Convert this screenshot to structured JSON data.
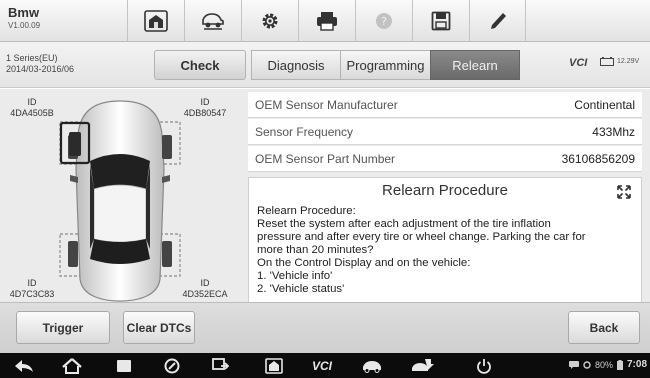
{
  "app": {
    "name": "Bmw",
    "version": "V1.00.09"
  },
  "toolbar": {
    "icons": [
      "home-icon",
      "vehicle-lift-icon",
      "settings-icon",
      "print-icon",
      "help-icon",
      "save-icon",
      "edit-icon"
    ]
  },
  "vehicle": {
    "model": "1 Series(EU)",
    "years": "2014/03-2016/06"
  },
  "function_bar": {
    "check_label": "Check",
    "tabs": [
      {
        "label": "Diagnosis",
        "active": false
      },
      {
        "label": "Programming",
        "active": false
      },
      {
        "label": "Relearn",
        "active": true
      }
    ],
    "vci_label": "VCI",
    "battery_voltage": "12.29V"
  },
  "tires": {
    "front_left": {
      "caption": "ID",
      "id": "4DA4505B",
      "selected": true
    },
    "front_right": {
      "caption": "ID",
      "id": "4DB80547",
      "selected": false
    },
    "rear_left": {
      "caption": "ID",
      "id": "4D7C3C83",
      "selected": false
    },
    "rear_right": {
      "caption": "ID",
      "id": "4D352ECA",
      "selected": false
    }
  },
  "sensor_info": [
    {
      "label": "OEM Sensor Manufacturer",
      "value": "Continental"
    },
    {
      "label": "Sensor Frequency",
      "value": "433Mhz"
    },
    {
      "label": "OEM Sensor Part Number",
      "value": "36106856209"
    }
  ],
  "procedure": {
    "title": "Relearn Procedure",
    "lines": [
      "Relearn Procedure:",
      "Reset the system after each adjustment of the tire inflation",
      "pressure and after every tire or wheel change. Parking the car for",
      "more than 20 minutes?",
      "On the Control Display and on the vehicle:",
      "1. 'Vehicle info'",
      "2. 'Vehicle status'"
    ]
  },
  "actions": {
    "trigger_label": "Trigger",
    "clear_dtcs_label": "Clear DTCs",
    "back_label": "Back"
  },
  "system_bar": {
    "battery_percent": "80%",
    "time": "7:08",
    "vci_label": "VCI"
  },
  "colors": {
    "active_tab": "#777777",
    "toolbar": "#e8e8e8",
    "nav_bar": "#0c0c0c"
  }
}
